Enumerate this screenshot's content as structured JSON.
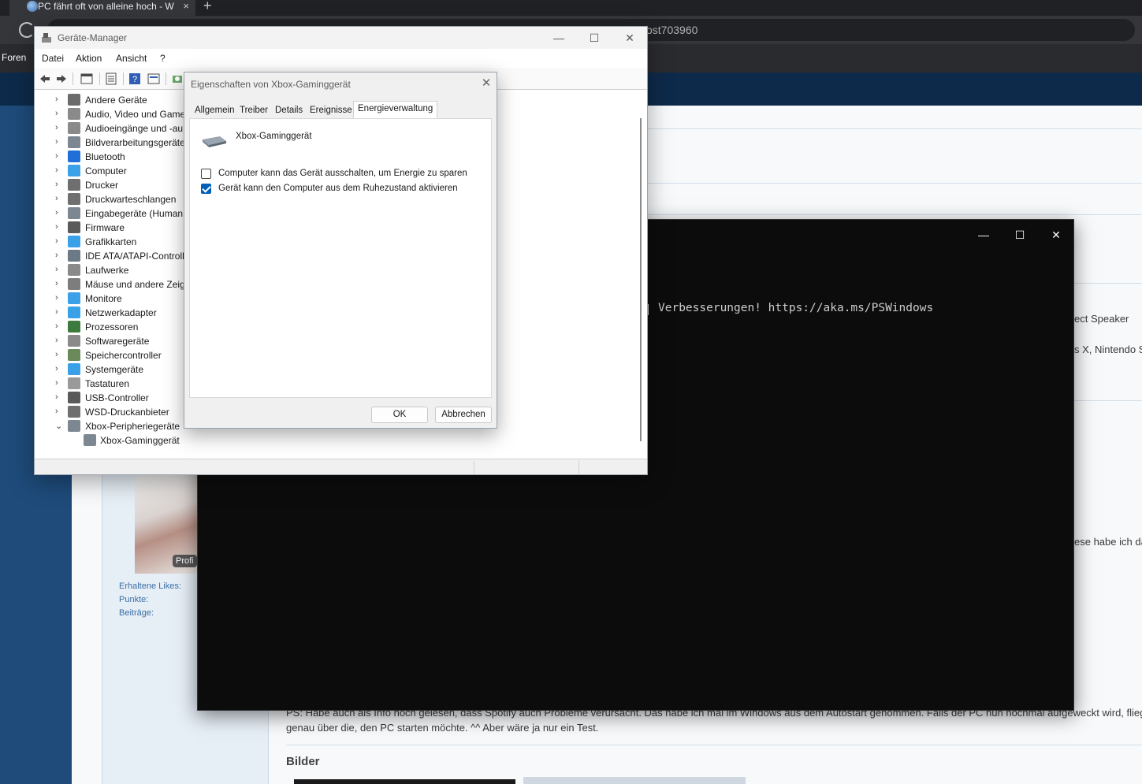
{
  "browser": {
    "tab_title": "PC fährt oft von alleine hoch - W",
    "tab_close": "×",
    "new_tab": "+",
    "address_fragment": "ost703960",
    "bookmark": "Foren"
  },
  "forum": {
    "avatar_badge": "Profi",
    "stats": [
      "Erhaltene Likes:",
      "Punkte:",
      "Beiträge:"
    ],
    "right_snippets": [
      "ect Speaker",
      "s X, Nintendo S",
      "ese habe ich da"
    ],
    "post_line_1": "PS: Habe auch als Info noch gelesen, dass Spotify auch Probleme verursacht. Das habe ich mal im Windows aus dem Autostart genommen. Falls der PC nun nochmal aufgeweckt wird, flieg",
    "post_line_2": "genau über die, den PC starten möchte. ^^ Aber wäre ja nur ein Test.",
    "section_title": "Bilder"
  },
  "terminal": {
    "line": "Verbesserungen! https://aka.ms/PSWindows",
    "btn_min": "—",
    "btn_max": "☐",
    "btn_close": "✕"
  },
  "device_manager": {
    "title": "Geräte-Manager",
    "btn_min": "—",
    "btn_max": "☐",
    "btn_close": "✕",
    "menu": [
      "Datei",
      "Aktion",
      "Ansicht",
      "?"
    ],
    "tree": [
      {
        "label": "Andere Geräte",
        "icon": "unknown-device-icon",
        "color": "#6b6b6b"
      },
      {
        "label": "Audio, Video und Game",
        "icon": "speaker-icon",
        "color": "#8a8a8a"
      },
      {
        "label": "Audioeingänge und -au",
        "icon": "speaker-icon",
        "color": "#8a8a8a"
      },
      {
        "label": "Bildverarbeitungsgeräte",
        "icon": "camera-icon",
        "color": "#7d8792"
      },
      {
        "label": "Bluetooth",
        "icon": "bluetooth-icon",
        "color": "#1f6fd6"
      },
      {
        "label": "Computer",
        "icon": "monitor-icon",
        "color": "#3aa0e8"
      },
      {
        "label": "Drucker",
        "icon": "printer-icon",
        "color": "#6f6f6f"
      },
      {
        "label": "Druckwarteschlangen",
        "icon": "printer-icon",
        "color": "#6f6f6f"
      },
      {
        "label": "Eingabegeräte (Human",
        "icon": "gamepad-icon",
        "color": "#7d8792"
      },
      {
        "label": "Firmware",
        "icon": "chip-icon",
        "color": "#5a5a5a"
      },
      {
        "label": "Grafikkarten",
        "icon": "display-adapter-icon",
        "color": "#3aa0e8"
      },
      {
        "label": "IDE ATA/ATAPI-Controlle",
        "icon": "controller-icon",
        "color": "#6b7a86"
      },
      {
        "label": "Laufwerke",
        "icon": "drive-icon",
        "color": "#8a8a8a"
      },
      {
        "label": "Mäuse und andere Zeig",
        "icon": "mouse-icon",
        "color": "#7d7d7d"
      },
      {
        "label": "Monitore",
        "icon": "monitor-icon",
        "color": "#3aa0e8"
      },
      {
        "label": "Netzwerkadapter",
        "icon": "network-icon",
        "color": "#3aa0e8"
      },
      {
        "label": "Prozessoren",
        "icon": "cpu-icon",
        "color": "#3d7a3d"
      },
      {
        "label": "Softwaregeräte",
        "icon": "software-device-icon",
        "color": "#8a8a8a"
      },
      {
        "label": "Speichercontroller",
        "icon": "storage-icon",
        "color": "#6b8a5a"
      },
      {
        "label": "Systemgeräte",
        "icon": "system-icon",
        "color": "#3aa0e8"
      },
      {
        "label": "Tastaturen",
        "icon": "keyboard-icon",
        "color": "#9a9a9a"
      },
      {
        "label": "USB-Controller",
        "icon": "usb-icon",
        "color": "#5a5a5a"
      },
      {
        "label": "WSD-Druckanbieter",
        "icon": "printer-icon",
        "color": "#6f6f6f"
      },
      {
        "label": "Xbox-Peripheriegeräte",
        "icon": "gamepad-icon",
        "color": "#7d8792"
      }
    ],
    "child_item": {
      "label": "Xbox-Gaminggerät",
      "icon": "gamepad-icon"
    }
  },
  "properties": {
    "title": "Eigenschaften von Xbox-Gaminggerät",
    "close": "✕",
    "tabs": [
      "Allgemein",
      "Treiber",
      "Details",
      "Ereignisse",
      "Energieverwaltung"
    ],
    "active_tab": "Energieverwaltung",
    "device_name": "Xbox-Gaminggerät",
    "options": [
      {
        "label": "Computer kann das Gerät ausschalten, um Energie zu sparen",
        "checked": false
      },
      {
        "label": "Gerät kann den Computer aus dem Ruhezustand aktivieren",
        "checked": true
      }
    ],
    "ok": "OK",
    "cancel": "Abbrechen"
  },
  "colors": {
    "accent": "#005fb8",
    "terminal_bg": "#0c0c0c",
    "forum_blue": "#1e4b7a"
  }
}
